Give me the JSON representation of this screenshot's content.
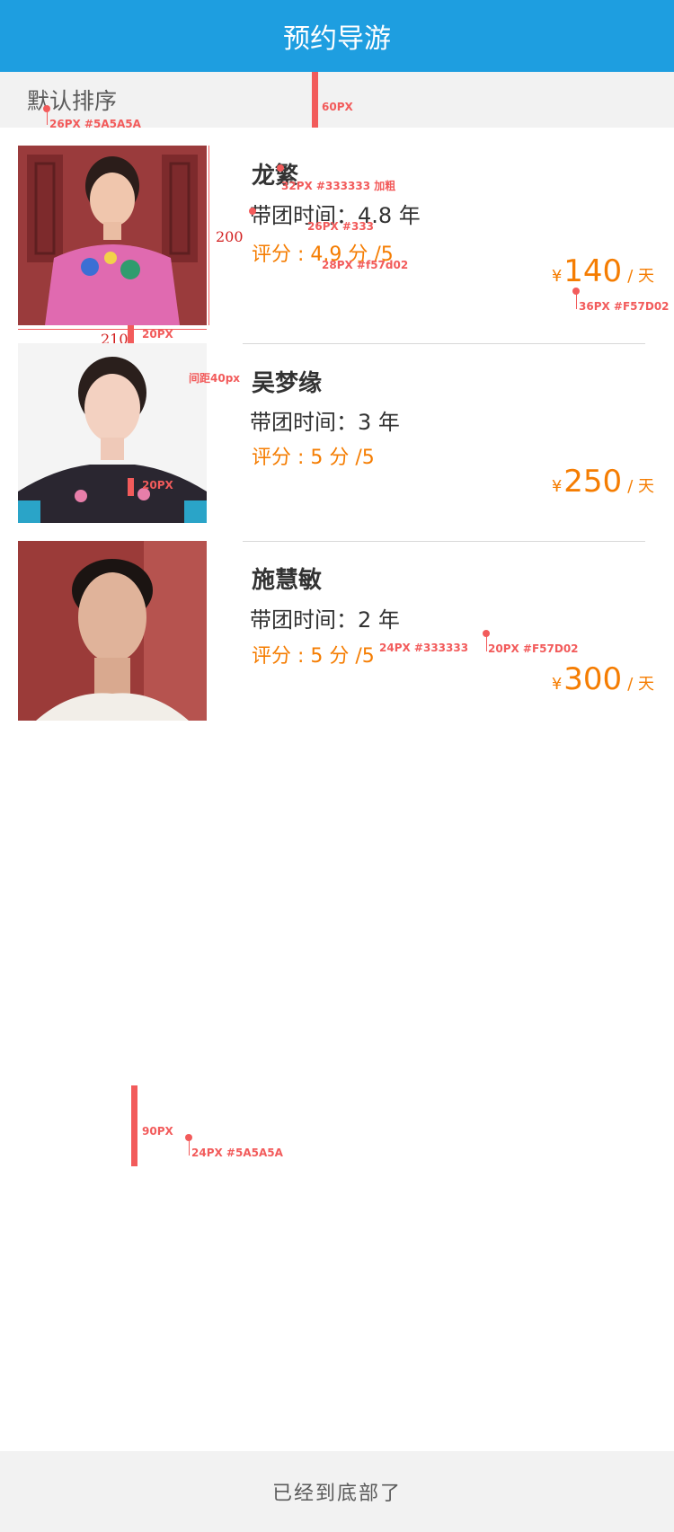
{
  "header": {
    "title": "预约导游"
  },
  "sortbar": {
    "label": "默认排序"
  },
  "guides": [
    {
      "name": "龙繁",
      "tenure": "带团时间：4.8 年",
      "rating": "评分 : 4.9 分 /5",
      "currency": "¥",
      "price": "140",
      "unit": "/ 天"
    },
    {
      "name": "吴梦缘",
      "tenure": "带团时间：3 年",
      "rating": "评分 : 5 分 /5",
      "currency": "¥",
      "price": "250",
      "unit": "/ 天"
    },
    {
      "name": "施慧敏",
      "tenure": "带团时间：2 年",
      "rating": "评分 : 5 分 /5",
      "currency": "¥",
      "price": "300",
      "unit": "/ 天"
    }
  ],
  "footer": {
    "text": "已经到底部了"
  },
  "annotations": {
    "sort_spec": "26PX #5A5A5A",
    "sortbar_height": "60PX",
    "name_spec": "32PX #333333 加粗",
    "tenure_spec": "26PX #333",
    "rating_spec": "28PX #f57d02",
    "price_spec": "36PX #F57D02",
    "photo_height": "200",
    "photo_width": "210",
    "gap_20": "20PX",
    "gap_40": "间距40px",
    "gap_20b": "20PX",
    "small_spec": "24PX #333333",
    "unit_spec": "20PX #F57D02",
    "footer_height": "90PX",
    "footer_spec": "24PX #5A5A5A"
  },
  "colors": {
    "header_bg": "#1e9ee0",
    "accent": "#f57d02",
    "text": "#333333",
    "muted": "#5a5a5a"
  }
}
